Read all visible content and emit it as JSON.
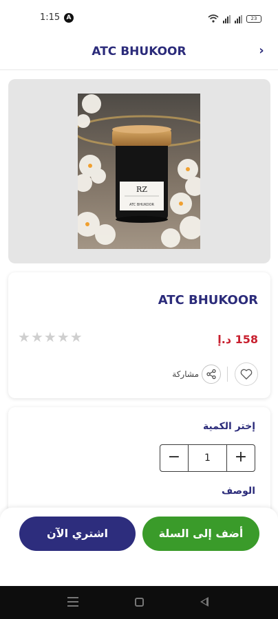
{
  "status_bar": {
    "time": "1:15",
    "notification_badge": "A",
    "battery": "23",
    "icons": [
      "wifi-icon",
      "signal-icon",
      "signal-icon",
      "battery-icon"
    ]
  },
  "header": {
    "title": "ATC BHUKOOR",
    "back_icon": "chevron-right-icon"
  },
  "product": {
    "name": "ATC BHUKOOR",
    "price": "158 د.إ",
    "rating": 0,
    "rating_max": 5,
    "share_label": "مشاركة",
    "image_label_brand": "RZ",
    "image_label_name": "ATC BHUKOOR"
  },
  "quantity": {
    "label": "إختر الكمية",
    "value": "1",
    "decrement": "−",
    "increment": "+"
  },
  "description": {
    "label": "الوصف"
  },
  "actions": {
    "add_to_cart": "أضف إلى السلة",
    "buy_now": "اشتري الآن"
  },
  "colors": {
    "brand_navy": "#2b2b7a",
    "price_red": "#c8202f",
    "cart_green": "#3a9b2a",
    "buy_navy": "#2d2d7d"
  }
}
